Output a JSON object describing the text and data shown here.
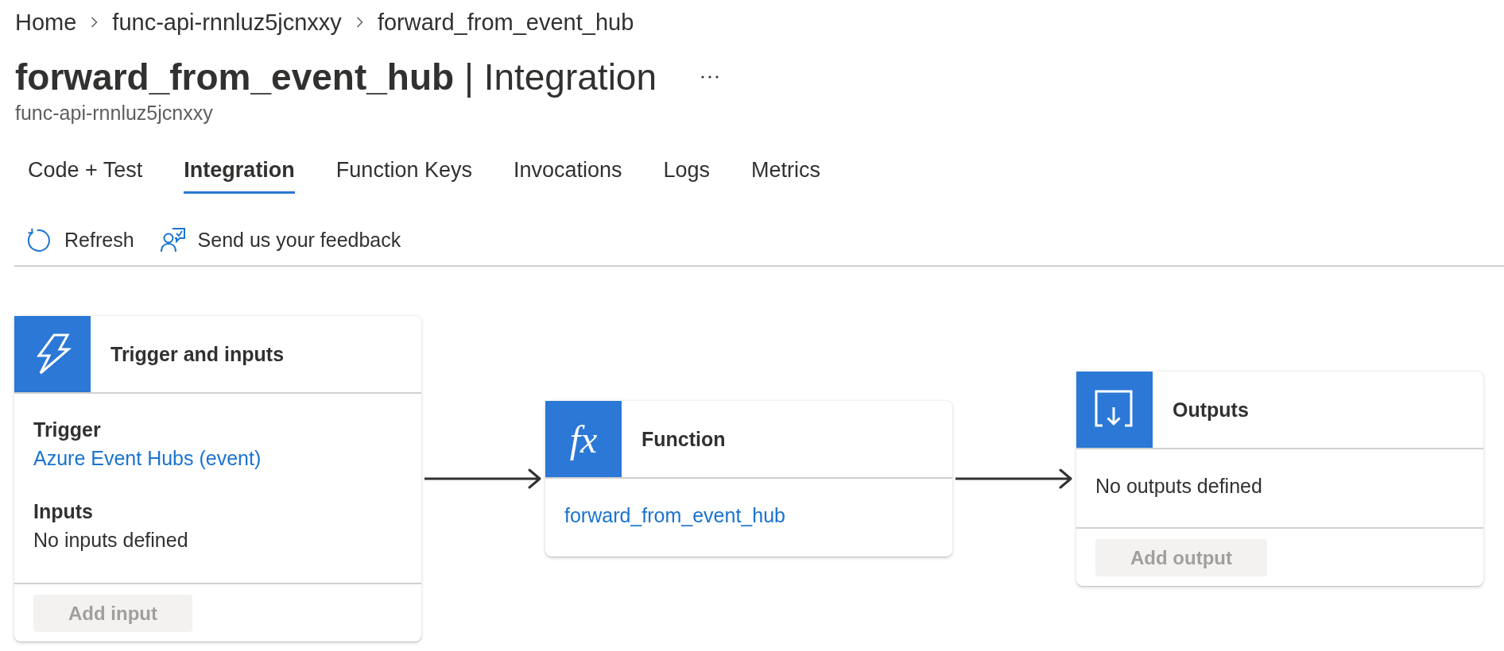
{
  "breadcrumb": [
    "Home",
    "func-api-rnnluz5jcnxxy",
    "forward_from_event_hub"
  ],
  "header": {
    "title": "**forward_from_event_hub** | Integration",
    "subtitle": "func-api-rnnluz5jcnxxy"
  },
  "tabs": [
    {
      "label": "Code + Test",
      "selected": false
    },
    {
      "label": "Integration",
      "selected": true
    },
    {
      "label": "Function Keys",
      "selected": false
    },
    {
      "label": "Invocations",
      "selected": false
    },
    {
      "label": "Logs",
      "selected": false
    },
    {
      "label": "Metrics",
      "selected": false
    }
  ],
  "toolbar": [
    {
      "kind": "refresh",
      "label": "Refresh"
    },
    {
      "kind": "feedback",
      "label": "Send us your feedback"
    }
  ],
  "cards": [
    {
      "kind": "trigger",
      "title": "Trigger and inputs",
      "sections": [
        {
          "heading": "Trigger",
          "link": "Azure Event Hubs (event)"
        },
        {
          "heading": "Inputs",
          "text": "No inputs defined"
        }
      ],
      "button": {
        "label": "Add input",
        "disabled": true
      }
    },
    {
      "kind": "function",
      "icon": "fx",
      "title": "Function",
      "link": "forward_from_event_hub"
    },
    {
      "kind": "outputs",
      "title": "Outputs",
      "text": "No outputs defined",
      "button": {
        "label": "Add output",
        "disabled": true
      }
    }
  ]
}
